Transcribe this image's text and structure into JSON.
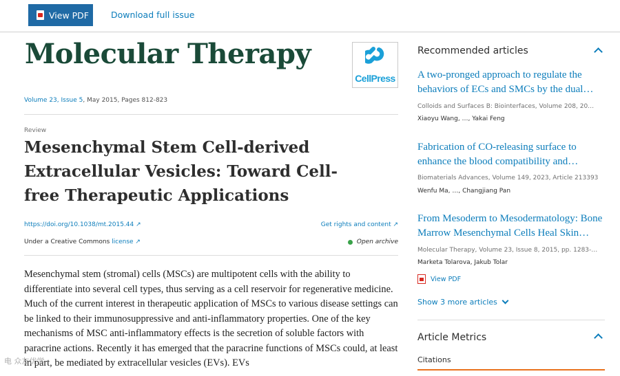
{
  "toolbar": {
    "view_pdf": "View PDF",
    "download_issue": "Download full issue"
  },
  "journal": {
    "title": "Molecular Therapy",
    "publisher_logo": "CellPress",
    "volume_link": "Volume 23, Issue 5",
    "volume_rest": ", May 2015, Pages 812-823"
  },
  "article": {
    "type": "Review",
    "title": "Mesenchymal Stem Cell-derived Extracellular Vesicles: Toward Cell-free Therapeutic Applications",
    "doi": "https://doi.org/10.1038/mt.2015.44 ↗",
    "rights": "Get rights and content ↗",
    "license_prefix": "Under a Creative Commons ",
    "license_link": "license ↗",
    "access": "Open archive",
    "abstract": "Mesenchymal stem (stromal) cells (MSCs) are multipotent cells with the ability to differentiate into several cell types, thus serving as a cell reservoir for regenerative medicine. Much of the current interest in therapeutic application of MSCs to various disease settings can be linked to their immunosuppressive and anti-inflammatory properties. One of the key mechanisms of MSC anti-inflammatory effects is the secretion of soluble factors with paracrine actions. Recently it has emerged that the paracrine functions of MSCs could, at least in part, be mediated by extracellular vesicles (EVs). EVs"
  },
  "sidebar": {
    "recommended_heading": "Recommended articles",
    "items": [
      {
        "title": "A two-pronged approach to regulate the behaviors of ECs and SMCs by the dual…",
        "source": "Colloids and Surfaces B: Biointerfaces, Volume 208, 20…",
        "authors": "Xiaoyu Wang, …, Yakai Feng"
      },
      {
        "title": "Fabrication of CO-releasing surface to enhance the blood compatibility and…",
        "source": "Biomaterials Advances, Volume 149, 2023, Article 213393",
        "authors": "Wenfu Ma, …, Changjiang Pan"
      },
      {
        "title": "From Mesoderm to Mesodermatology: Bone Marrow Mesenchymal Cells Heal Skin…",
        "source": "Molecular Therapy, Volume 23, Issue 8, 2015, pp. 1283-…",
        "authors": "Marketa Tolarova, Jakub Tolar"
      }
    ],
    "view_pdf": "View PDF",
    "show_more": "Show 3 more articles",
    "metrics_heading": "Article Metrics",
    "citations": "Citations"
  },
  "watermark": "电 众友优学",
  "colors": {
    "brand_blue": "#1f6aa5",
    "link_blue": "#0c7dbb",
    "journal_green": "#1a4a38",
    "open_access_green": "#3aa24a",
    "metrics_orange": "#e9711c"
  }
}
